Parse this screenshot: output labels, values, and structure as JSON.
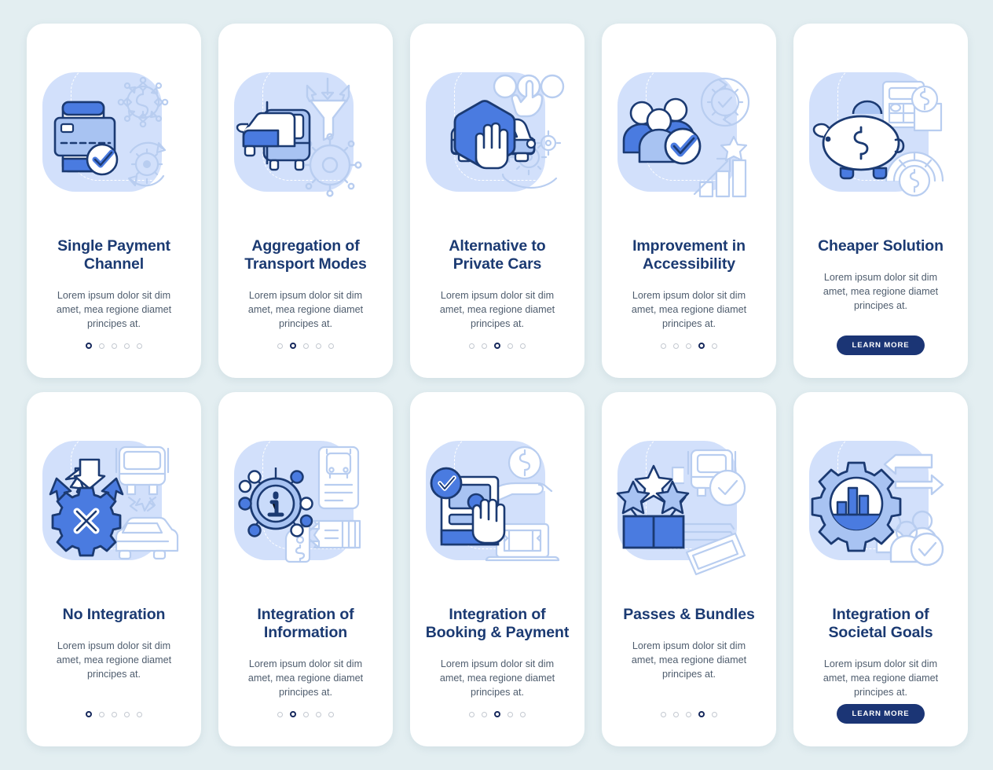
{
  "page": {
    "background_color": "#e3eef1",
    "card_background": "#ffffff",
    "title_color": "#1b3a72",
    "body_color": "#4f5d6e",
    "accent_color": "#4a7be0",
    "cta_color": "#1b3575",
    "illustration_bg_color": "#d2e0fb",
    "dot_active_color": "#16285c",
    "dot_inactive_color": "#c3c8d0"
  },
  "shared": {
    "body_text": "Lorem ipsum dolor sit dim amet, mea regione diamet principes at.",
    "cta_label": "LEARN MORE",
    "dots_total": 5
  },
  "rows": [
    {
      "screens": [
        {
          "title": "Single Payment Channel",
          "body": "Lorem ipsum dolor sit dim amet, mea regione diamet principes at.",
          "icon": "payment-card-phone-icon",
          "dots_total": 5,
          "dot_active": 1,
          "has_cta": false,
          "cta_label": ""
        },
        {
          "title": "Aggregation of Transport Modes",
          "body": "Lorem ipsum dolor sit dim amet, mea regione diamet principes at.",
          "icon": "bus-funnel-gear-icon",
          "dots_total": 5,
          "dot_active": 2,
          "has_cta": false,
          "cta_label": ""
        },
        {
          "title": "Alternative to Private Cars",
          "body": "Lorem ipsum dolor sit dim amet, mea regione diamet principes at.",
          "icon": "stop-hand-car-icon",
          "dots_total": 5,
          "dot_active": 3,
          "has_cta": false,
          "cta_label": ""
        },
        {
          "title": "Improvement in Accessibility",
          "body": "Lorem ipsum dolor sit dim amet, mea regione diamet principes at.",
          "icon": "people-check-chart-icon",
          "dots_total": 5,
          "dot_active": 4,
          "has_cta": false,
          "cta_label": ""
        },
        {
          "title": "Cheaper Solution",
          "body": "Lorem ipsum dolor sit dim amet, mea regione diamet principes at.",
          "icon": "piggy-bank-calculator-icon",
          "dots_total": 0,
          "dot_active": 0,
          "has_cta": true,
          "cta_label": "LEARN MORE"
        }
      ]
    },
    {
      "screens": [
        {
          "title": "No Integration",
          "body": "Lorem ipsum dolor sit dim amet, mea regione diamet principes at.",
          "icon": "broken-gear-cross-icon",
          "dots_total": 5,
          "dot_active": 1,
          "has_cta": false,
          "cta_label": ""
        },
        {
          "title": "Integration of Information",
          "body": "Lorem ipsum dolor sit dim amet, mea regione diamet principes at.",
          "icon": "info-network-ticket-icon",
          "dots_total": 5,
          "dot_active": 2,
          "has_cta": false,
          "cta_label": ""
        },
        {
          "title": "Integration of Booking & Payment",
          "body": "Lorem ipsum dolor sit dim amet, mea regione diamet principes at.",
          "icon": "booking-payment-hand-icon",
          "dots_total": 5,
          "dot_active": 3,
          "has_cta": false,
          "cta_label": ""
        },
        {
          "title": "Passes & Bundles",
          "body": "Lorem ipsum dolor sit dim amet, mea regione diamet principes at.",
          "icon": "bundle-box-stars-tickets-icon",
          "dots_total": 5,
          "dot_active": 4,
          "has_cta": false,
          "cta_label": ""
        },
        {
          "title": "Integration of Societal Goals",
          "body": "Lorem ipsum dolor sit dim amet, mea regione diamet principes at.",
          "icon": "gear-chart-people-arrows-icon",
          "dots_total": 0,
          "dot_active": 0,
          "has_cta": true,
          "cta_label": "LEARN MORE"
        }
      ]
    }
  ]
}
